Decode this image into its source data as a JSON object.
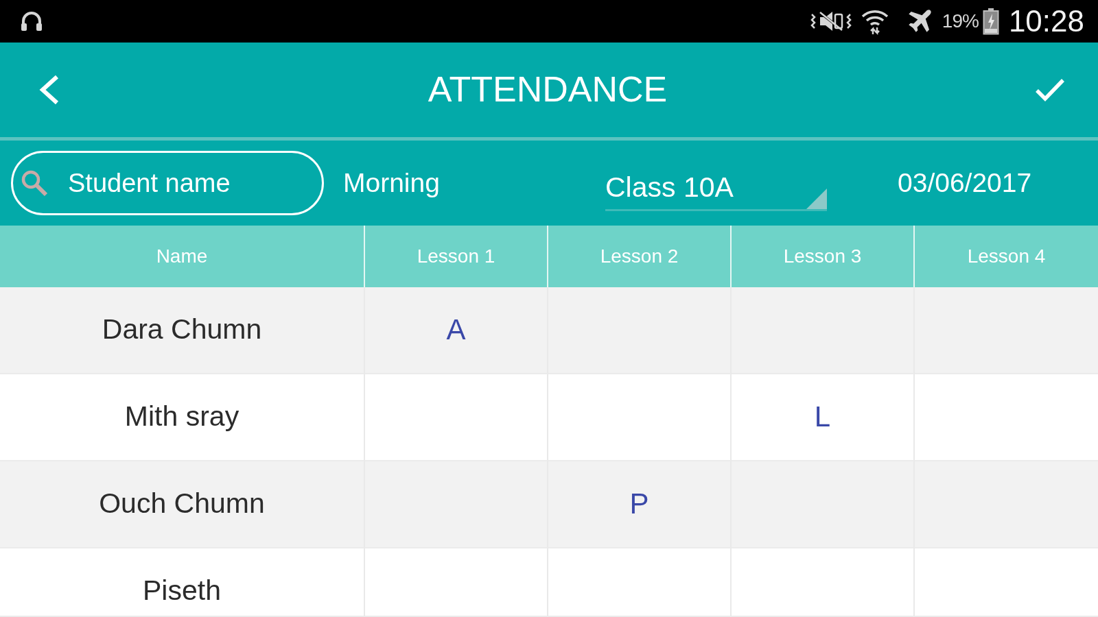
{
  "status_bar": {
    "battery_text": "19%",
    "time": "10:28"
  },
  "app_bar": {
    "title": "ATTENDANCE"
  },
  "filters": {
    "search": {
      "placeholder": "Student name"
    },
    "session": "Morning",
    "class_dropdown": {
      "value": "Class 10A"
    },
    "date": "03/06/2017"
  },
  "table": {
    "columns": [
      "Name",
      "Lesson 1",
      "Lesson 2",
      "Lesson 3",
      "Lesson 4"
    ],
    "rows": [
      [
        "Dara Chumn",
        "A",
        "",
        "",
        ""
      ],
      [
        "Mith sray",
        "",
        "",
        "L",
        ""
      ],
      [
        "Ouch Chumn",
        "",
        "P",
        "",
        ""
      ],
      [
        "Piseth",
        "",
        "",
        "",
        ""
      ]
    ]
  }
}
